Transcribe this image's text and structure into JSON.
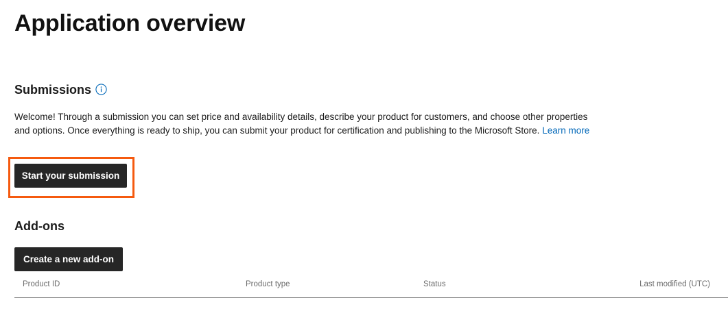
{
  "page": {
    "title": "Application overview"
  },
  "submissions": {
    "heading": "Submissions",
    "info_icon": "info-icon",
    "description": "Welcome! Through a submission you can set price and availability details, describe your product for customers, and choose other properties and options. Once everything is ready to ship, you can submit your product for certification and publishing to the Microsoft Store.",
    "learn_more": "Learn more",
    "start_button": "Start your submission",
    "highlight_color": "#f55a0f"
  },
  "addons": {
    "heading": "Add-ons",
    "create_button": "Create a new add-on",
    "columns": [
      "Product ID",
      "Product type",
      "Status",
      "Last modified (UTC)"
    ]
  },
  "colors": {
    "button_bg": "#262626",
    "link": "#0067b8"
  }
}
